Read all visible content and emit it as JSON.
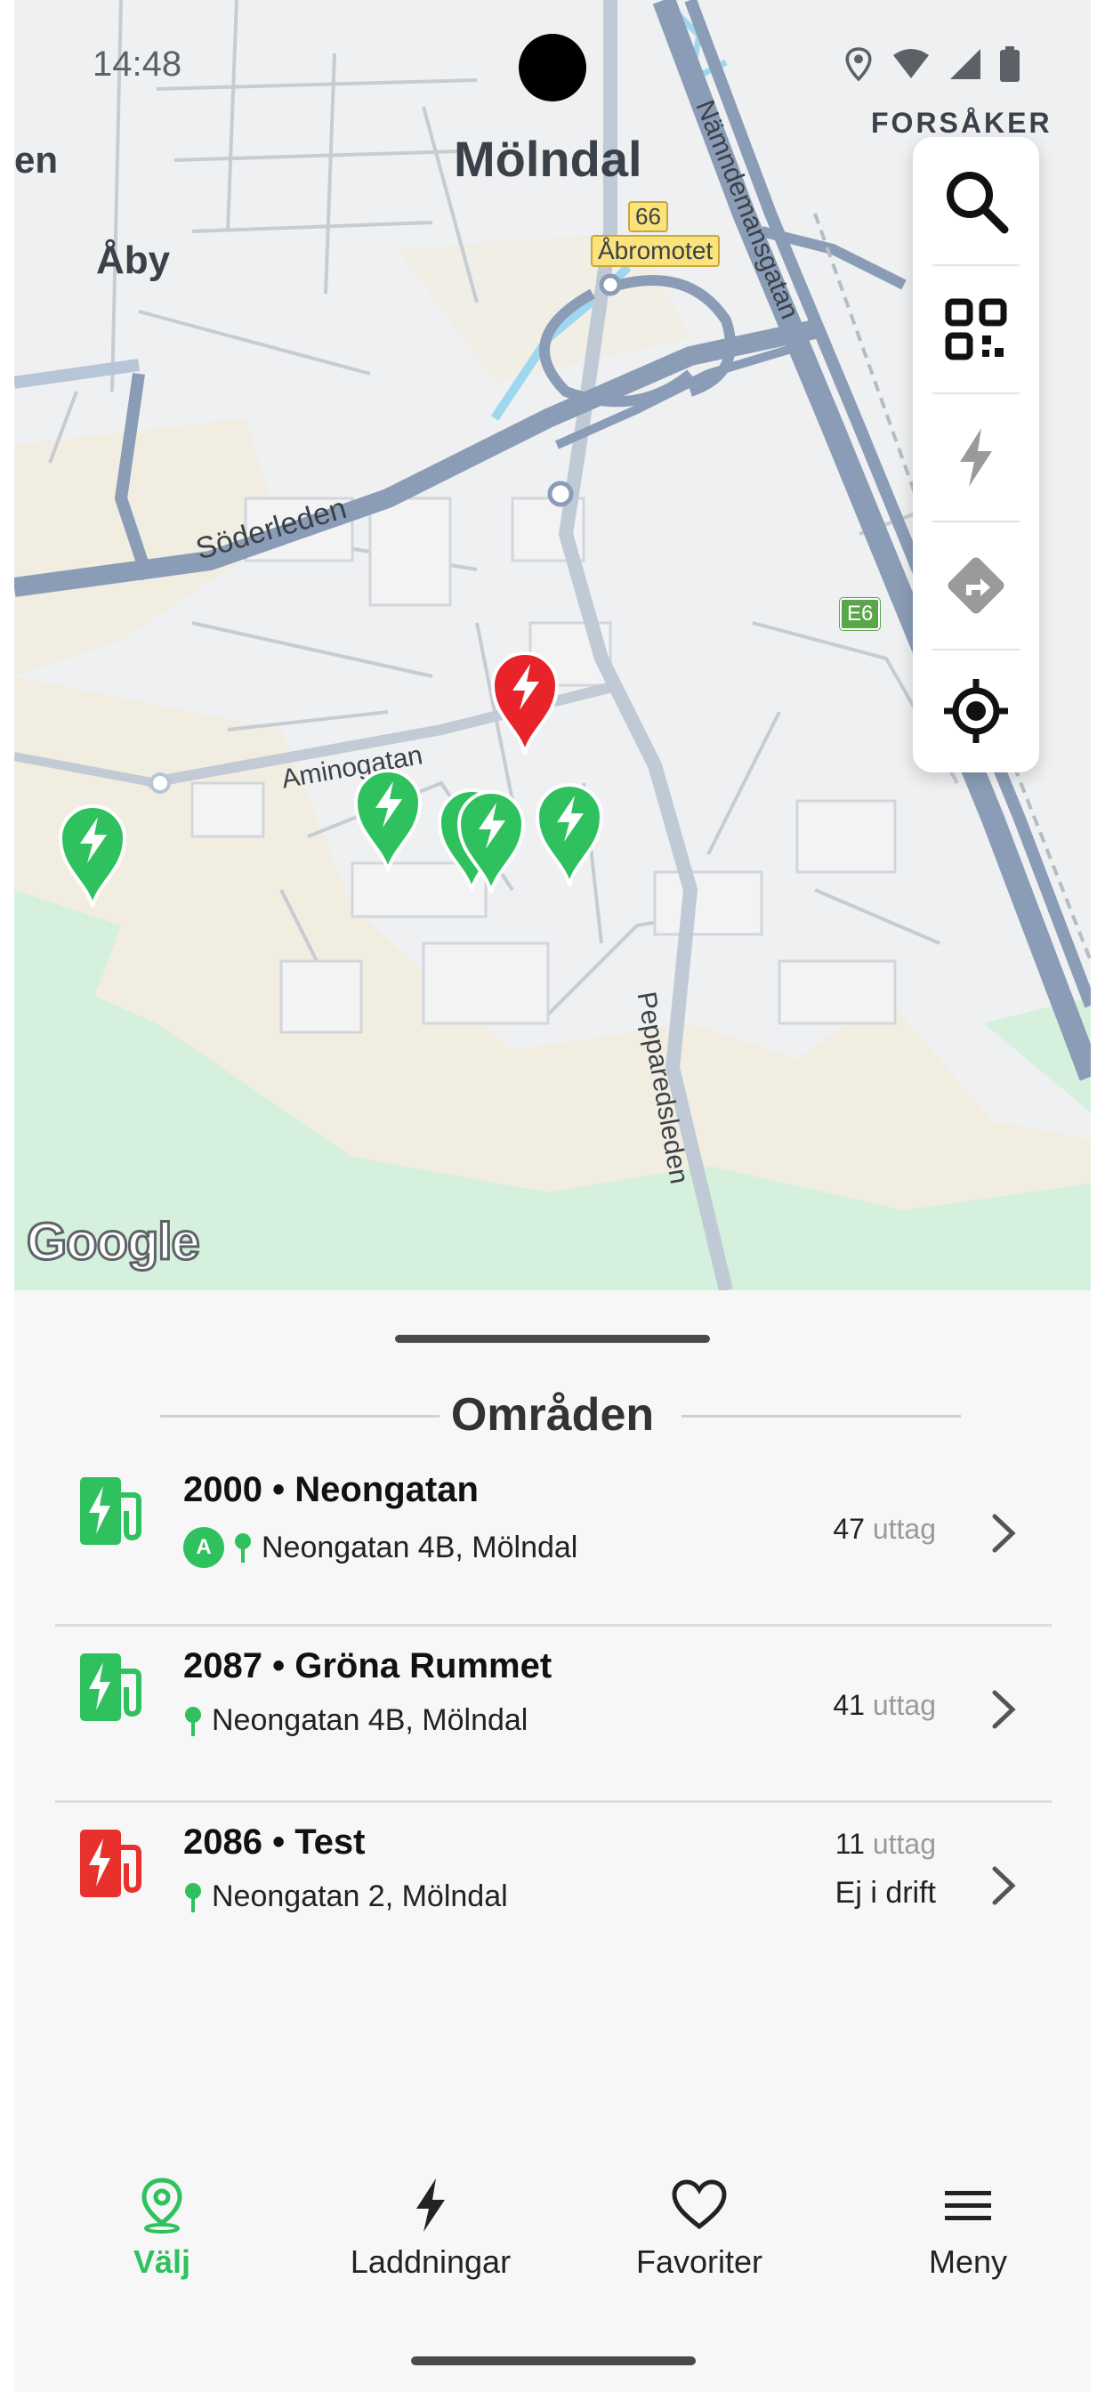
{
  "status_bar": {
    "time": "14:48"
  },
  "map": {
    "labels": {
      "molndal": "Mölndal",
      "aby": "Åby",
      "forsaker": "FORSÅKER",
      "en": "en",
      "abromotet": "Åbromotet",
      "route_66": "66",
      "soderleden": "Söderleden",
      "aminogatan": "Aminogatan",
      "namndemansgatan": "Nämndemansgatan",
      "pepparedsleden": "Pepparedsleden",
      "e6": "E6",
      "google": "Google"
    },
    "colors": {
      "pin_green": "#2ec15e",
      "pin_red": "#e8232a",
      "road": "#8b9db6",
      "park": "#d5f0dc",
      "sand": "#f1ede1"
    }
  },
  "toolbox": {
    "tools": [
      {
        "icon": "search-icon"
      },
      {
        "icon": "qr-code-icon"
      },
      {
        "icon": "lightning-icon"
      },
      {
        "icon": "directions-icon"
      },
      {
        "icon": "my-location-icon"
      }
    ]
  },
  "sheet": {
    "title": "Områden",
    "areas": [
      {
        "title": "2000 • Neongatan",
        "badge": "A",
        "address": "Neongatan 4B, Mölndal",
        "count": "47",
        "unit": "uttag",
        "status": "",
        "state": "available"
      },
      {
        "title": "2087 • Gröna Rummet",
        "badge": "",
        "address": "Neongatan 4B, Mölndal",
        "count": "41",
        "unit": "uttag",
        "status": "",
        "state": "available"
      },
      {
        "title": "2086 • Test",
        "badge": "",
        "address": "Neongatan 2, Mölndal",
        "count": "11",
        "unit": "uttag",
        "status": "Ej i drift",
        "state": "offline"
      }
    ]
  },
  "nav": {
    "items": [
      {
        "label": "Välj",
        "icon": "location-pin-icon",
        "active": true
      },
      {
        "label": "Laddningar",
        "icon": "lightning-icon",
        "active": false
      },
      {
        "label": "Favoriter",
        "icon": "heart-icon",
        "active": false
      },
      {
        "label": "Meny",
        "icon": "menu-icon",
        "active": false
      }
    ],
    "accent": "#2ec15e"
  }
}
